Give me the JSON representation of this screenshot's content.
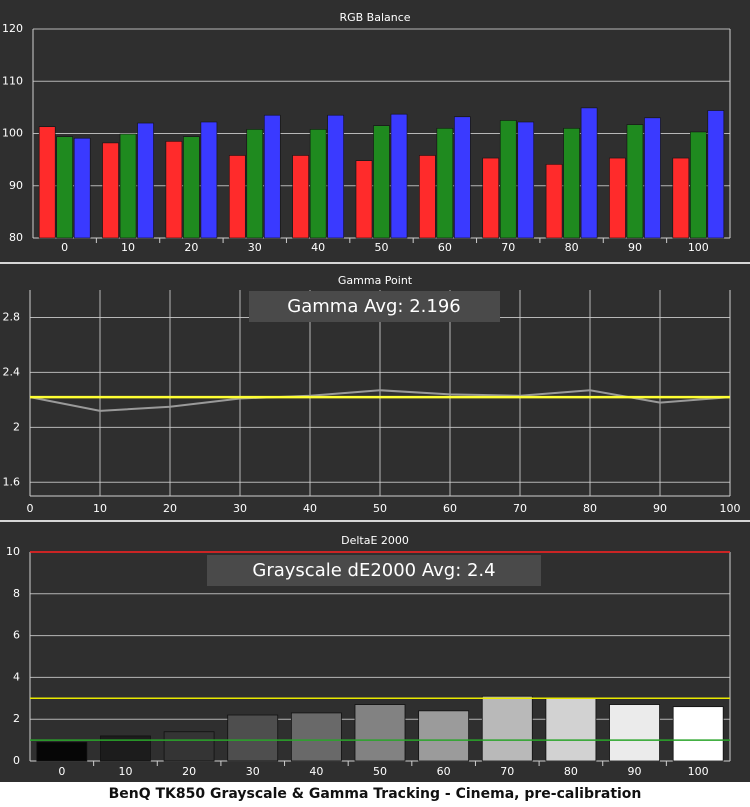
{
  "caption": "BenQ TK850 Grayscale & Gamma Tracking - Cinema, pre-calibration",
  "colors": {
    "panel_bg": "#2f2f2f",
    "grid": "#cfcfcf",
    "red": "#ff2b2b",
    "green": "#1f8a1f",
    "blue": "#3a3aff",
    "gamma_measured": "#9a9a9a",
    "gamma_target": "#ffff33",
    "de_limit_high": "#ff2020",
    "de_limit_mid": "#e8e800",
    "de_limit_low": "#2aa52a"
  },
  "chart_data": [
    {
      "type": "bar",
      "title": "RGB Balance",
      "categories": [
        "0",
        "10",
        "20",
        "30",
        "40",
        "50",
        "60",
        "70",
        "80",
        "90",
        "100"
      ],
      "series": [
        {
          "name": "",
          "color": "red",
          "values": [
            101.3,
            98.2,
            98.5,
            95.8,
            95.8,
            94.8,
            95.8,
            95.3,
            94.1,
            95.3,
            95.3
          ]
        },
        {
          "name": "",
          "color": "green",
          "values": [
            99.4,
            99.9,
            99.4,
            100.8,
            100.8,
            101.5,
            101.0,
            102.5,
            101.0,
            101.7,
            100.3
          ]
        },
        {
          "name": "",
          "color": "blue",
          "values": [
            99.1,
            102.0,
            102.2,
            103.5,
            103.5,
            103.7,
            103.2,
            102.2,
            104.9,
            103.0,
            104.4
          ]
        }
      ],
      "ylim": [
        80,
        120
      ],
      "yticks": [
        "80",
        "90",
        "100",
        "110",
        "120"
      ],
      "grid": true
    },
    {
      "type": "line",
      "title": "Gamma Point",
      "annotation": "Gamma Avg: 2.196",
      "x": [
        0,
        10,
        20,
        30,
        40,
        50,
        60,
        70,
        80,
        90,
        100
      ],
      "xticks": [
        "0",
        "10",
        "20",
        "30",
        "40",
        "50",
        "60",
        "70",
        "80",
        "90",
        "100"
      ],
      "series": [
        {
          "name": "",
          "color": "gamma_measured",
          "values": [
            2.22,
            2.12,
            2.15,
            2.21,
            2.23,
            2.27,
            2.24,
            2.23,
            2.27,
            2.18,
            2.22
          ]
        },
        {
          "name": "",
          "color": "gamma_target",
          "values": [
            2.22,
            2.22,
            2.22,
            2.22,
            2.22,
            2.22,
            2.22,
            2.22,
            2.22,
            2.22,
            2.22
          ]
        }
      ],
      "xlim": [
        0,
        100
      ],
      "ylim": [
        1.5,
        3.0
      ],
      "yticks": [
        "1.6",
        "2",
        "2.4",
        "2.8"
      ],
      "grid": true
    },
    {
      "type": "bar",
      "title": "DeltaE 2000",
      "annotation": "Grayscale dE2000 Avg: 2.4",
      "categories": [
        "0",
        "10",
        "20",
        "30",
        "40",
        "50",
        "60",
        "70",
        "80",
        "90",
        "100"
      ],
      "values": [
        0.9,
        1.2,
        1.4,
        2.2,
        2.3,
        2.7,
        2.4,
        3.1,
        3.0,
        2.7,
        2.6
      ],
      "bar_gray": [
        6,
        28,
        52,
        78,
        105,
        130,
        155,
        185,
        210,
        235,
        255
      ],
      "thresholds": [
        {
          "value": 10,
          "color": "de_limit_high"
        },
        {
          "value": 3,
          "color": "de_limit_mid"
        },
        {
          "value": 1,
          "color": "de_limit_low"
        }
      ],
      "ylim": [
        0,
        10
      ],
      "yticks": [
        "0",
        "2",
        "4",
        "6",
        "8",
        "10"
      ],
      "grid": true
    }
  ]
}
